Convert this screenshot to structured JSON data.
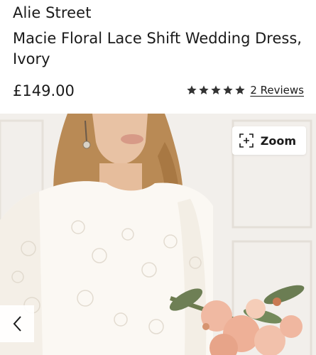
{
  "product": {
    "brand": "Alie Street",
    "title": "Macie Floral Lace Shift Wedding Dress, Ivory",
    "price": "£149.00",
    "rating": 5,
    "reviews_label": "2 Reviews"
  },
  "gallery": {
    "zoom_label": "Zoom",
    "zoom_icon": "zoom-expand-icon",
    "prev_icon": "chevron-left-icon",
    "image_subject": "model in ivory lace dress holding peach bouquet"
  },
  "colors": {
    "text": "#1a1a1a",
    "star": "#333333",
    "background": "#ffffff"
  }
}
